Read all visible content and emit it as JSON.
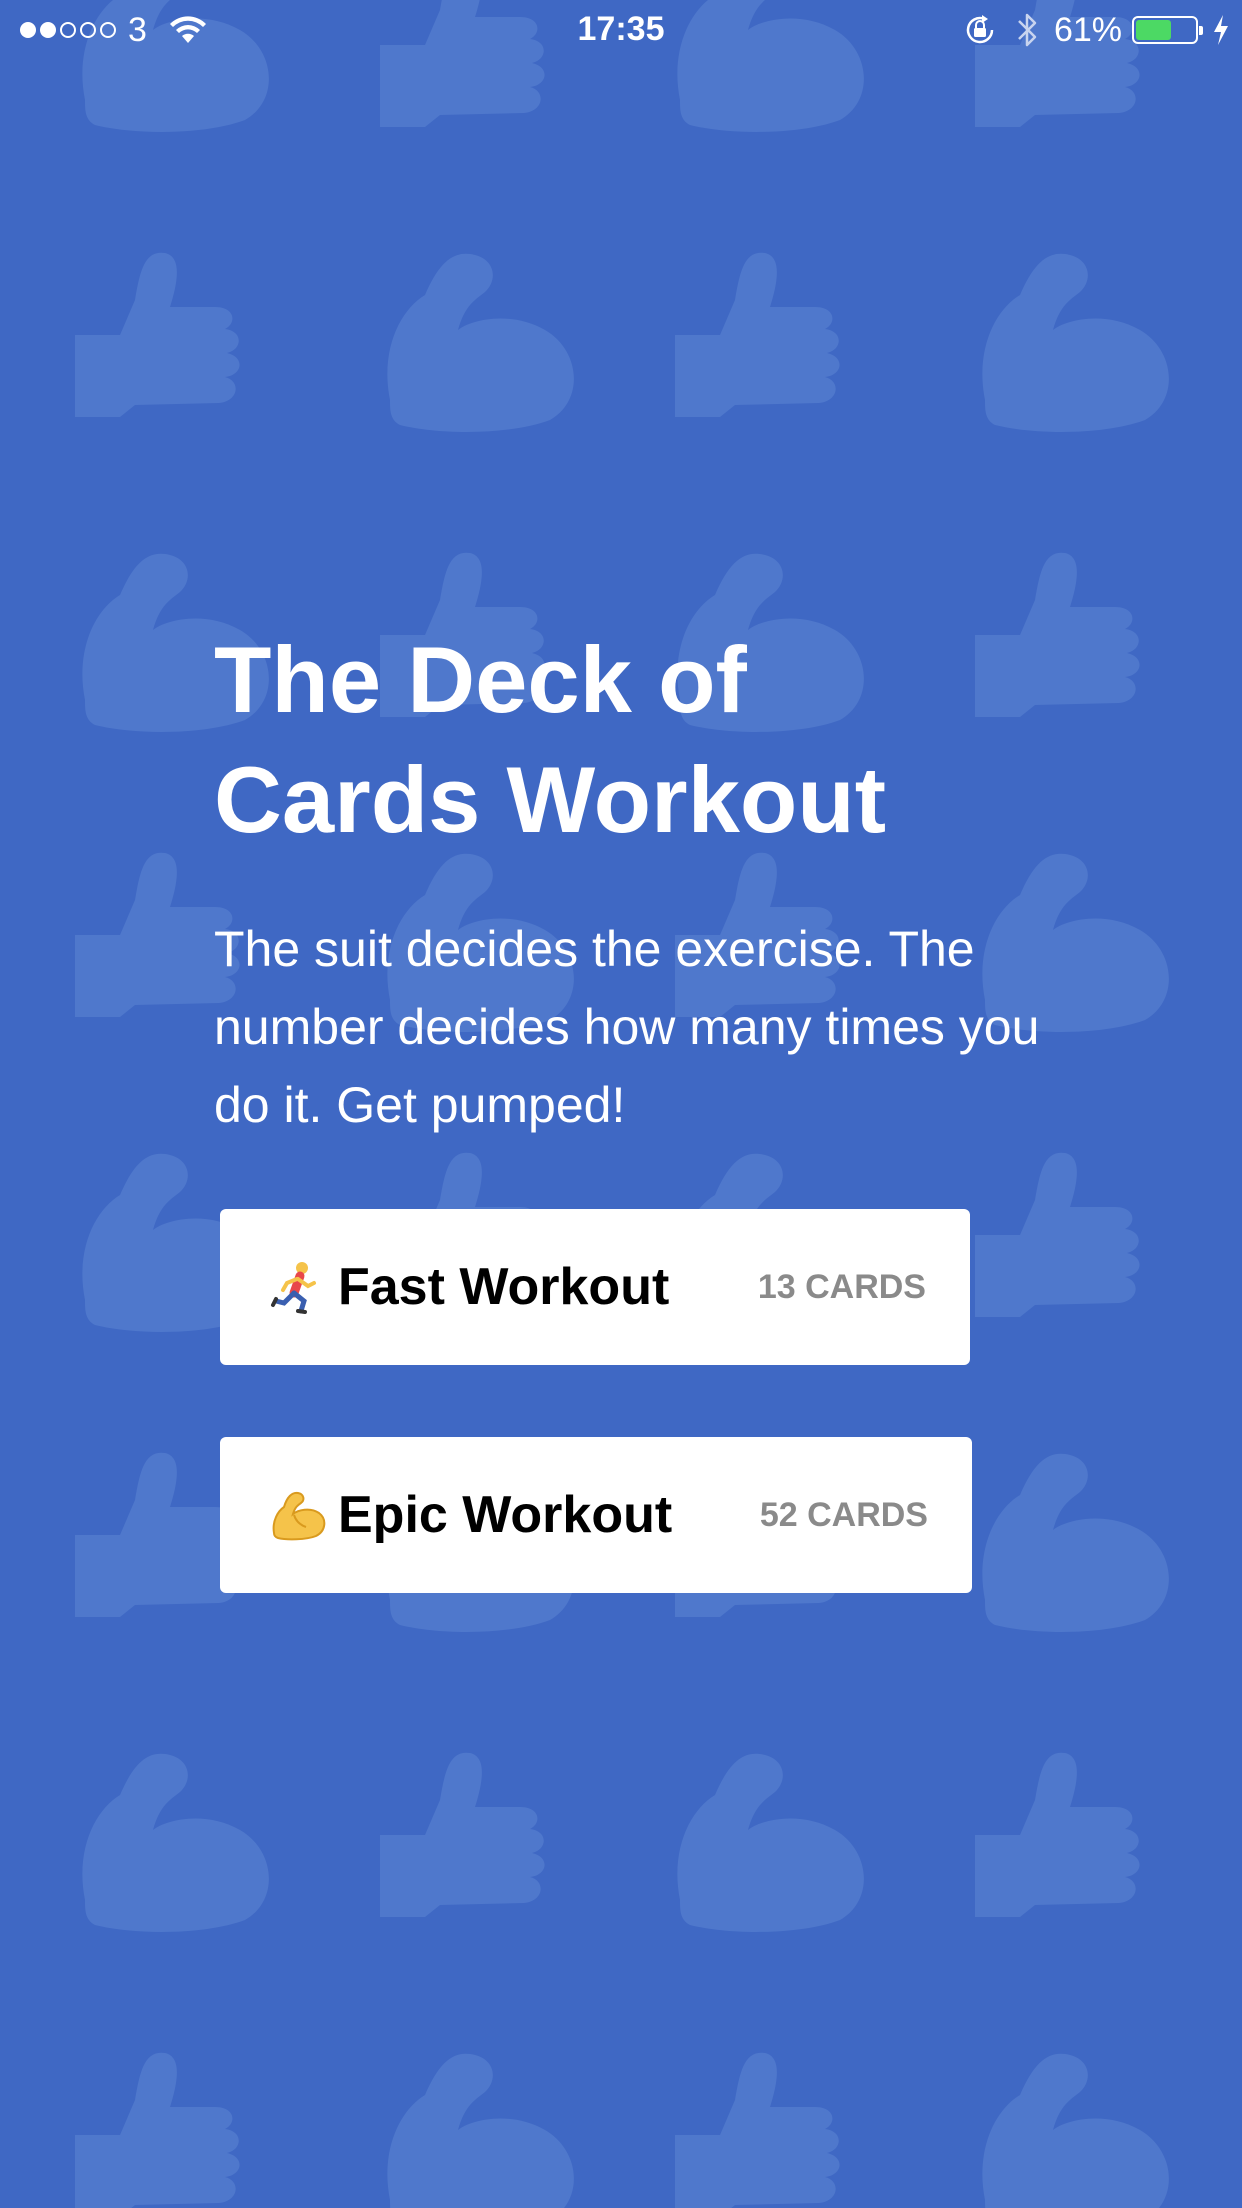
{
  "status_bar": {
    "signal_dots_filled": 2,
    "signal_dots_total": 5,
    "carrier": "3",
    "time": "17:35",
    "battery_percent": "61%",
    "battery_level": 0.61,
    "battery_color": "#4cd964",
    "icons": [
      "wifi-icon",
      "rotation-lock-icon",
      "bluetooth-icon",
      "battery-icon",
      "charging-bolt-icon"
    ]
  },
  "background": {
    "color": "#3f68c4",
    "pattern_icons": [
      "flexed-biceps-icon",
      "thumbs-up-icon"
    ]
  },
  "main": {
    "title": "The Deck of Cards Workout",
    "title_line1": "The Deck of",
    "title_line2": "Cards Workout",
    "description": "The suit decides the exercise. The number decides how many times you do it. Get pumped!",
    "buttons": [
      {
        "icon": "runner-icon",
        "label": "Fast Workout",
        "count": "13 CARDS"
      },
      {
        "icon": "flexed-biceps-icon",
        "label": "Epic Workout",
        "count": "52 CARDS"
      }
    ]
  }
}
